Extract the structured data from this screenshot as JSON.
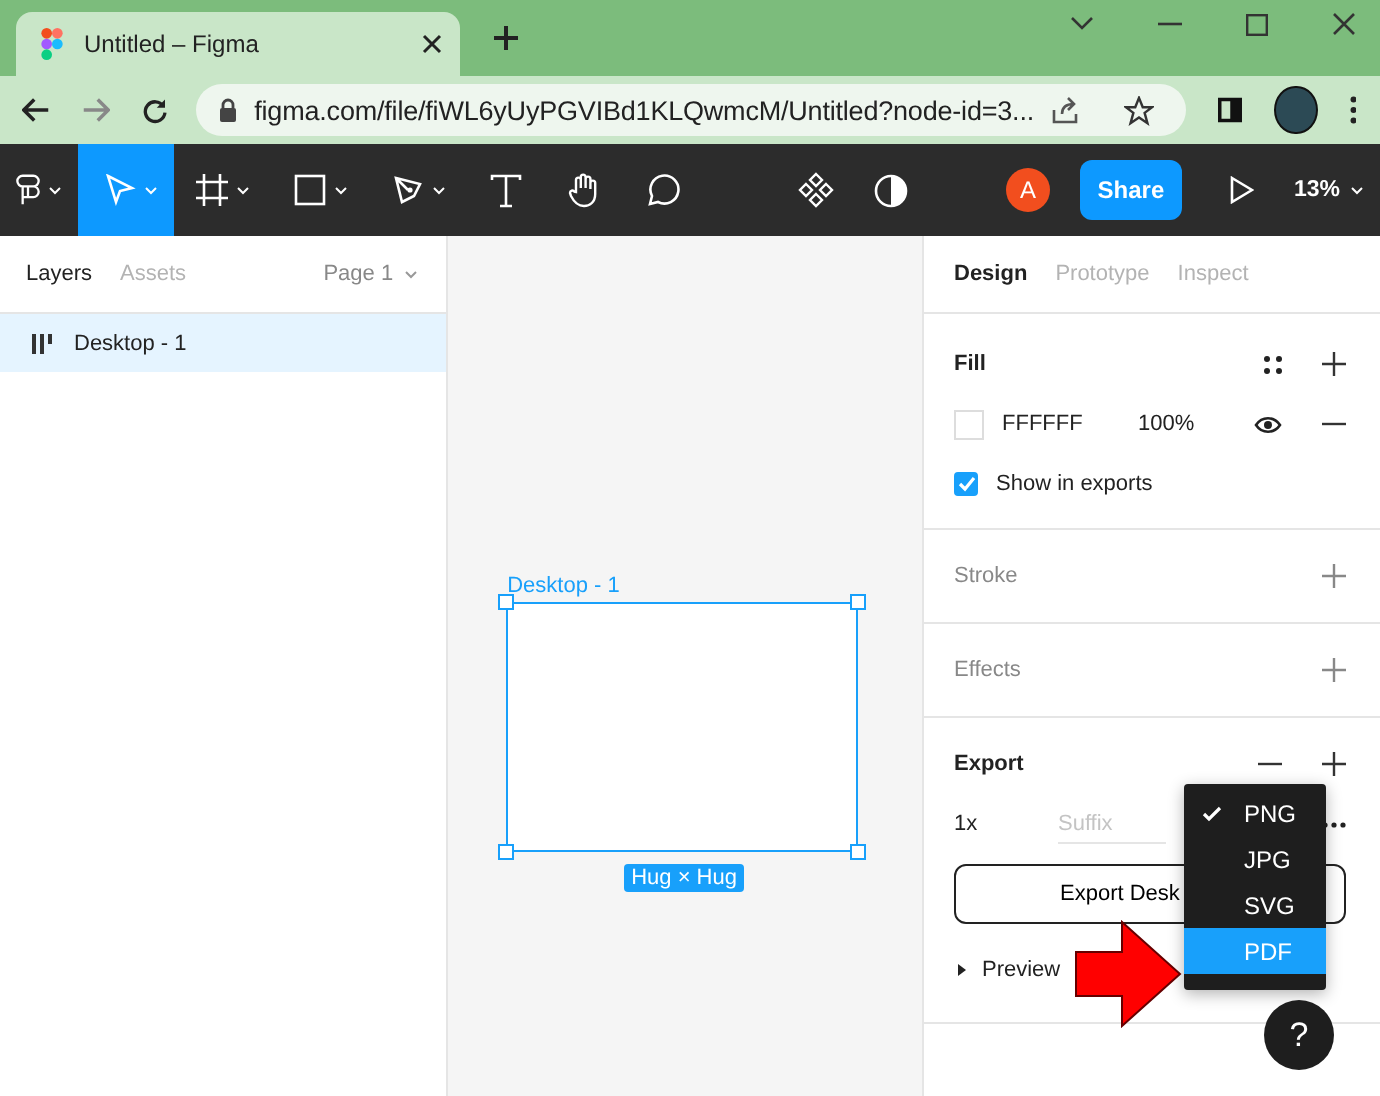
{
  "browser": {
    "tab_title": "Untitled – Figma",
    "url": "figma.com/file/fiWL6yUyPGVIBd1KLQwmcM/Untitled?node-id=3..."
  },
  "toolbar": {
    "tools": [
      {
        "kind": "move",
        "selected": true
      },
      {
        "kind": "frame",
        "selected": false
      },
      {
        "kind": "rect",
        "selected": false
      },
      {
        "kind": "pen",
        "selected": false
      },
      {
        "kind": "text",
        "selected": false
      },
      {
        "kind": "hand",
        "selected": false
      },
      {
        "kind": "comment",
        "selected": false
      }
    ],
    "avatar": "A",
    "share": "Share",
    "zoom": "13%"
  },
  "left_panel": {
    "tabs": [
      {
        "label": "Layers",
        "selected": true
      },
      {
        "label": "Assets",
        "selected": false
      }
    ],
    "page": "Page 1",
    "layers": [
      {
        "name": "Desktop - 1",
        "selected": true
      }
    ]
  },
  "canvas": {
    "frame_label": "Desktop - 1",
    "size_badge": "Hug × Hug"
  },
  "right_panel": {
    "tabs": [
      {
        "label": "Design",
        "selected": true
      },
      {
        "label": "Prototype",
        "selected": false
      },
      {
        "label": "Inspect",
        "selected": false
      }
    ],
    "fill": {
      "title": "Fill",
      "hex": "FFFFFF",
      "opacity": "100%",
      "show_in_exports": {
        "label": "Show in exports",
        "checked": true
      }
    },
    "sections": [
      "Stroke",
      "Effects"
    ],
    "export": {
      "title": "Export",
      "scale": "1x",
      "suffix_placeholder": "Suffix",
      "button": "Export Desk",
      "preview": "Preview",
      "formats": [
        {
          "label": "PNG",
          "checked": true,
          "selected": false
        },
        {
          "label": "JPG",
          "checked": false,
          "selected": false
        },
        {
          "label": "SVG",
          "checked": false,
          "selected": false
        },
        {
          "label": "PDF",
          "checked": false,
          "selected": true
        }
      ]
    }
  },
  "help": "?"
}
